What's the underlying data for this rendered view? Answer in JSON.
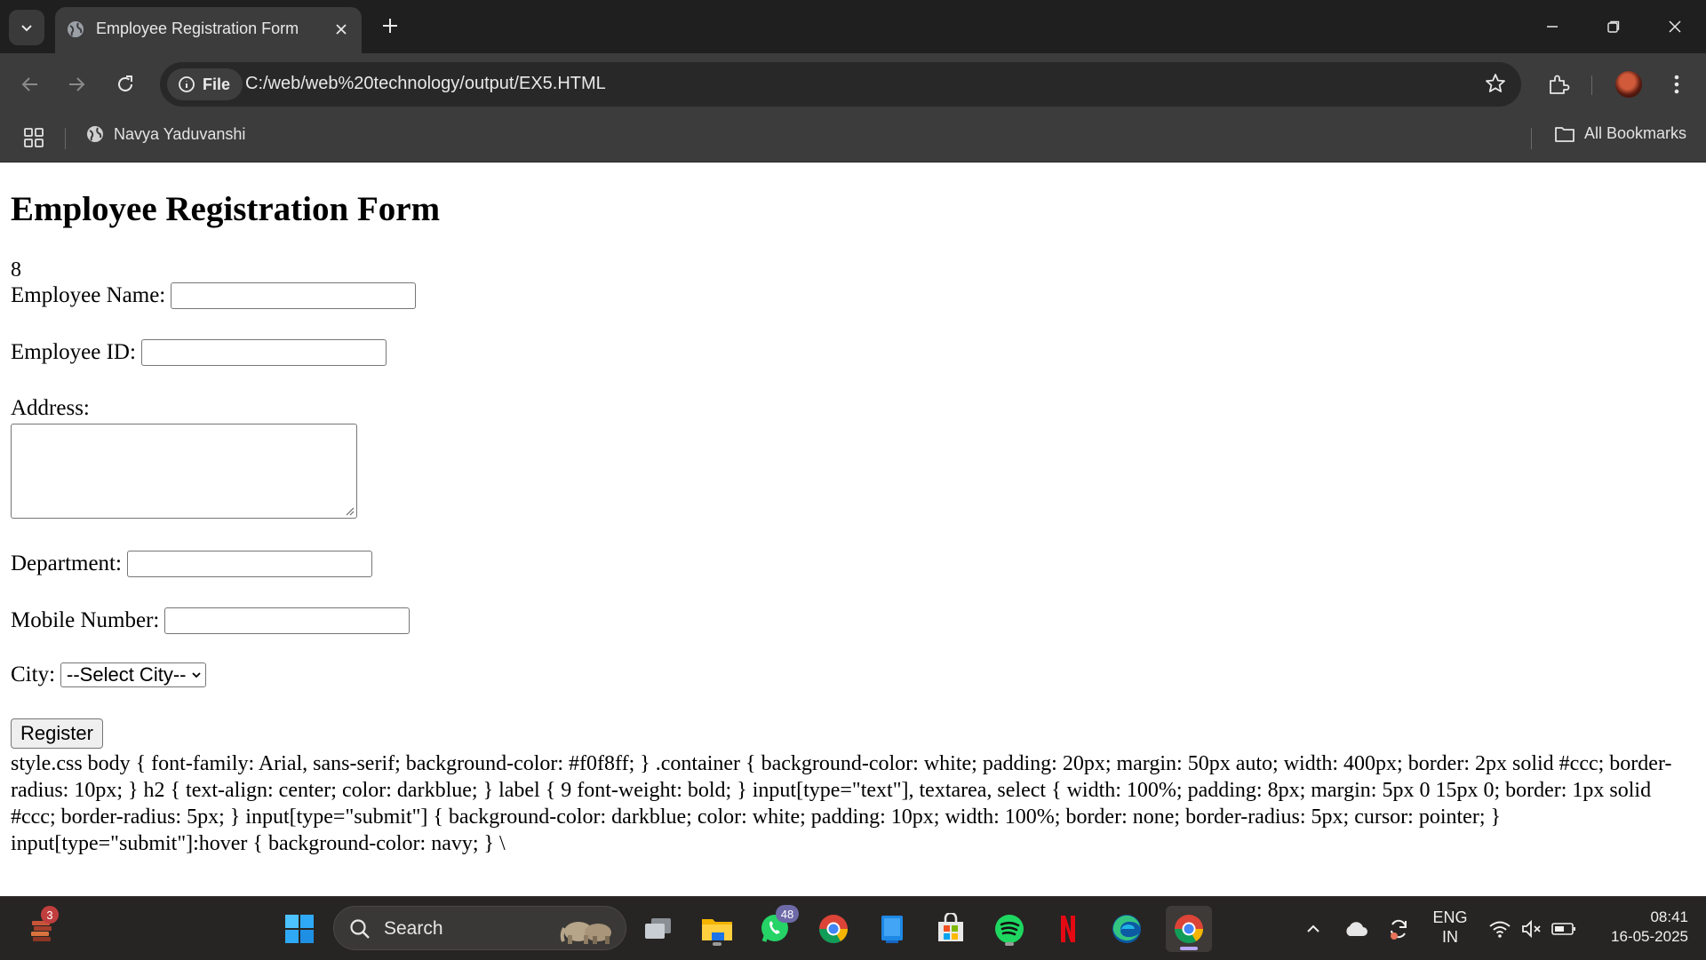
{
  "browser": {
    "tab_title": "Employee Registration Form",
    "site_chip": "File",
    "url": "C:/web/web%20technology/output/EX5.HTML",
    "bookmark": "Navya Yaduvanshi",
    "all_bookmarks": "All Bookmarks"
  },
  "page": {
    "heading": "Employee Registration Form",
    "stray_text": "8",
    "fields": {
      "name_label": "Employee Name:",
      "id_label": "Employee ID:",
      "address_label": "Address:",
      "department_label": "Department:",
      "mobile_label": "Mobile Number:",
      "city_label": "City:",
      "city_selected": "--Select City--"
    },
    "register_button": "Register",
    "css_dump": "style.css body { font-family: Arial, sans-serif; background-color: #f0f8ff; } .container { background-color: white; padding: 20px; margin: 50px auto; width: 400px; border: 2px solid #ccc; border-radius: 10px; } h2 { text-align: center; color: darkblue; } label { 9 font-weight: bold; } input[type=\"text\"], textarea, select { width: 100%; padding: 8px; margin: 5px 0 15px 0; border: 1px solid #ccc; border-radius: 5px; } input[type=\"submit\"] { background-color: darkblue; color: white; padding: 10px; width: 100%; border: none; border-radius: 5px; cursor: pointer; } input[type=\"submit\"]:hover { background-color: navy; } \\"
  },
  "taskbar": {
    "search_label": "Search",
    "notification_count": "3",
    "whatsapp_badge": "48",
    "language": "ENG",
    "region": "IN",
    "time": "08:41",
    "date": "16-05-2025"
  },
  "icons": [
    "tab-list-icon",
    "globe-icon",
    "close-icon",
    "plus-icon",
    "minimize-icon",
    "restore-icon",
    "back-icon",
    "forward-icon",
    "reload-icon",
    "info-icon",
    "star-icon",
    "extensions-icon",
    "menu-icon",
    "apps-icon",
    "folder-icon",
    "search-icon",
    "windows-icon",
    "chevron-up-icon",
    "cloud-icon",
    "wifi-icon",
    "mute-icon",
    "battery-icon"
  ],
  "colors": {
    "tabbar": "#1f1f1f",
    "toolbar": "#3c3c3c",
    "omnibox": "#282828",
    "taskbar": "#272523"
  }
}
